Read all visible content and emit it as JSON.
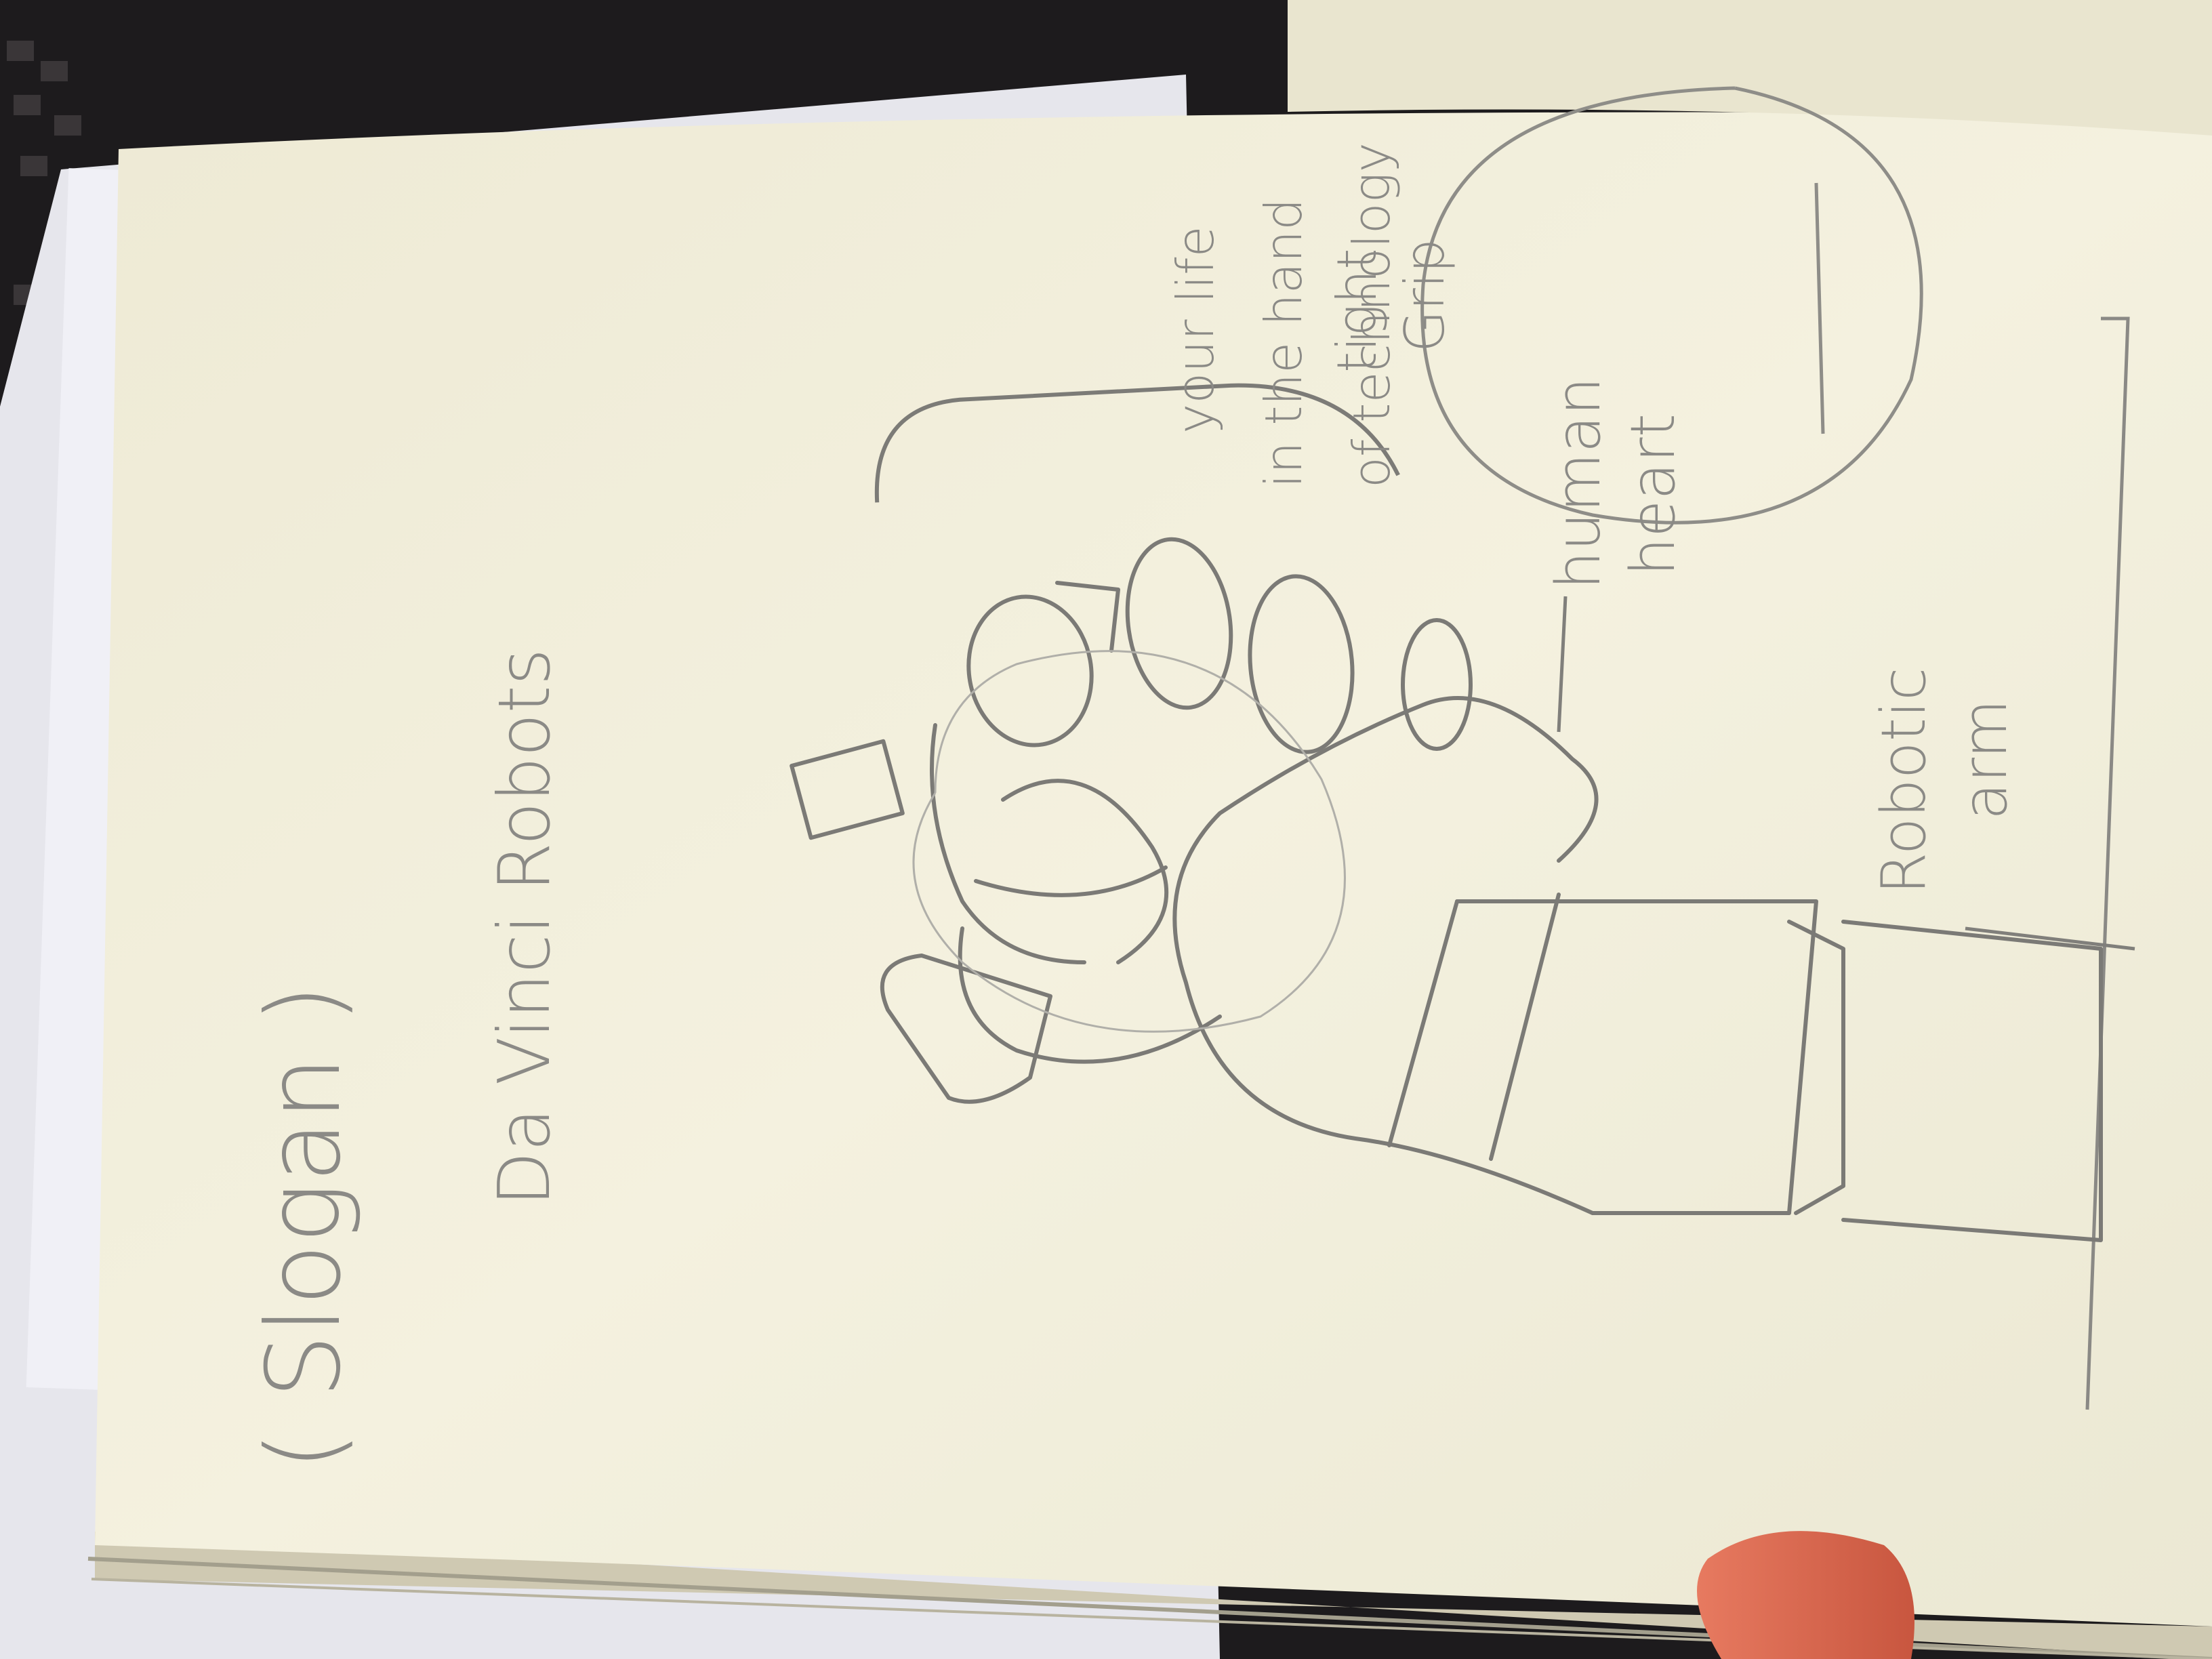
{
  "sketch": {
    "slogan_placeholder": "( Slogan )",
    "brand_name": "Da Vinci Robots",
    "tagline_line1": "your life",
    "tagline_line2": "in the hand",
    "tagline_line3": "of technology",
    "label_tight_grip_1": "tight",
    "label_tight_grip_2": "Grip",
    "label_human_heart_1": "human",
    "label_human_heart_2": "heart",
    "label_robotic_arm_1": "Robotic",
    "label_robotic_arm_2": "arm"
  },
  "colors": {
    "paper": "#f2efdc",
    "pencil": "#7b7a76",
    "background": "#1d1b1d",
    "finger": "#e0705a"
  }
}
